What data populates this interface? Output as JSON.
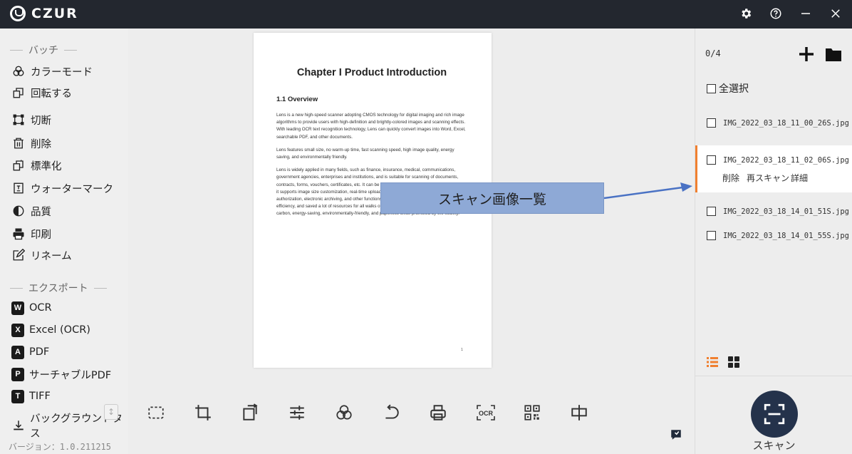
{
  "app": {
    "name": "CZUR"
  },
  "titlebar": {
    "icons": [
      "gear-icon",
      "help-icon",
      "minimize-icon",
      "close-icon"
    ]
  },
  "sidebar": {
    "batch_header": "バッチ",
    "batch_items": [
      {
        "label": "カラーモード",
        "icon": "color-mode-icon"
      },
      {
        "label": "回転する",
        "icon": "rotate-icon"
      },
      {
        "label": "切断",
        "icon": "crop-icon"
      },
      {
        "label": "削除",
        "icon": "trash-icon"
      },
      {
        "label": "標準化",
        "icon": "standardize-icon"
      },
      {
        "label": "ウォーターマーク",
        "icon": "watermark-icon"
      },
      {
        "label": "品質",
        "icon": "quality-icon"
      },
      {
        "label": "印刷",
        "icon": "print-icon"
      },
      {
        "label": "リネーム",
        "icon": "rename-icon"
      }
    ],
    "export_header": "エクスポート",
    "export_items": [
      {
        "label": "OCR",
        "badge": "W"
      },
      {
        "label": "Excel (OCR)",
        "badge": "X"
      },
      {
        "label": "PDF",
        "badge": "A"
      },
      {
        "label": "サーチャブルPDF",
        "badge": "P"
      },
      {
        "label": "TIFF",
        "badge": "T"
      }
    ],
    "background_task": "バックグラウンドタス",
    "version": "バージョン：1.0.211215"
  },
  "document": {
    "title": "Chapter I Product Introduction",
    "section": "1.1 Overview",
    "paragraphs": [
      "Lens is a new high-speed scanner adopting CMOS technology for digital imaging and rich image algorithms to provide users with high-definition and brightly-colored images and scanning effects. With leading OCR text recognition technology, Lens can quickly convert images into Word, Excel, searchable PDF, and other documents.",
      "Lens features small size, no warm-up time, fast scanning speed, high image quality, energy saving, and environmentally friendly.",
      "Lens is widely applied in many fields, such as finance, insurance, medical, communications, government agencies, enterprises and institutions, and is suitable for scanning of documents, contracts, forms, vouchers, certificates, etc. It can be applied on system integration requirements, it supports image size customization, real-time uploading, electronic approval, electronic authorization, electronic archiving, and other functions, which have greatly increased users' work efficiency, and saved a lot of resources for all walks of life. It is in line with the strategy of low-carbon, energy-saving, environmentally-friendly, and paperless office promoted by the society."
    ],
    "page_number": "1"
  },
  "callout": {
    "text": "スキャン画像一覧",
    "color": "#8ea9d6"
  },
  "toolbar": {
    "tools": [
      "select-icon",
      "crop-icon",
      "rotate-icon",
      "adjust-icon",
      "color-mode-icon",
      "undo-icon",
      "print-icon",
      "ocr-icon",
      "qrcode-icon",
      "split-icon"
    ],
    "ocr_label": "OCR"
  },
  "right_panel": {
    "count": "0/4",
    "select_all": "全選択",
    "files": [
      {
        "name": "IMG_2022_03_18_11_00_26S.jpg"
      },
      {
        "name": "IMG_2022_03_18_11_02_06S.jpg",
        "active": true,
        "actions": [
          "削除",
          "再スキャン",
          "詳細"
        ]
      },
      {
        "name": "IMG_2022_03_18_14_01_51S.jpg"
      },
      {
        "name": "IMG_2022_03_18_14_01_55S.jpg"
      }
    ],
    "active_color": "#f08030"
  },
  "scan": {
    "label": "スキャン",
    "color": "#24324b"
  }
}
